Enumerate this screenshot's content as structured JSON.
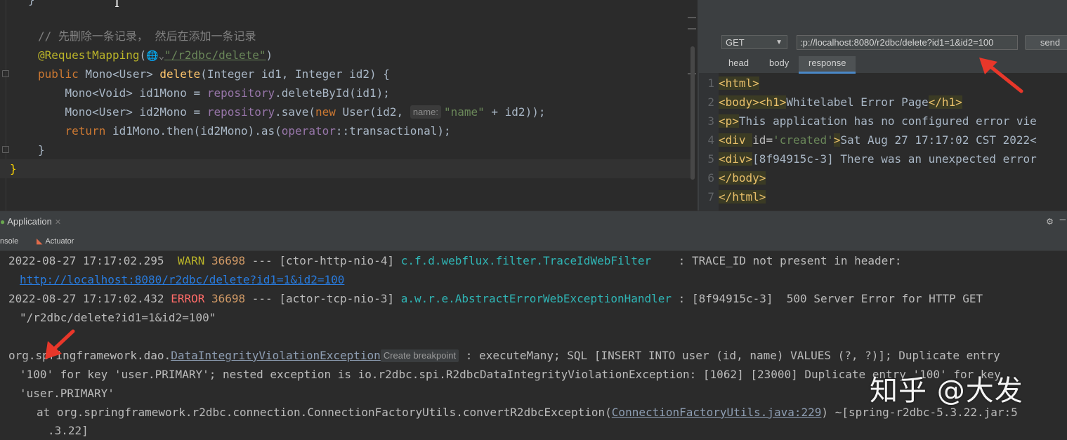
{
  "editor": {
    "lines": {
      "comment": "// 先删除一条记录， 然后在添加一条记录",
      "annotation": "@RequestMapping",
      "annotation_open": "(",
      "globe_hint": "🌐⌄",
      "annotation_path": "\"/r2dbc/delete\"",
      "annotation_close": ")",
      "sig_public": "public",
      "sig_type": " Mono<User> ",
      "sig_name": "delete",
      "sig_params": "(Integer id1, Integer id2) {",
      "l1_a": "    Mono<Void> id1Mono = ",
      "l1_field": "repository",
      "l1_b": ".deleteById(id1);",
      "l2_a": "    Mono<User> id2Mono = ",
      "l2_field": "repository",
      "l2_b": ".save(",
      "l2_new": "new",
      "l2_c": " User(id2, ",
      "l2_hint": "name:",
      "l2_str": "\"name\"",
      "l2_d": " + id2));",
      "l3_return": "    return",
      "l3_a": " id1Mono.then(id2Mono).as(",
      "l3_field": "operator",
      "l3_b": "::transactional);",
      "close_inner": "}",
      "close_outer": "}",
      "top_brace": "}",
      "cursor_glyph": "I"
    }
  },
  "http_client": {
    "method": "GET",
    "url": ":p://localhost:8080/r2dbc/delete?id1=1&id2=100",
    "send_label": "send",
    "tabs": [
      {
        "label": "head"
      },
      {
        "label": "body"
      },
      {
        "label": "response"
      }
    ],
    "response_lines": [
      {
        "n": "1",
        "t1": "<html>",
        "t2": "",
        "t3": ""
      },
      {
        "n": "2",
        "t1": "<body><h1>",
        "t2": "Whitelabel Error Page",
        "t3": "</h1>"
      },
      {
        "n": "3",
        "t1": "<p>",
        "t2": "This application has no configured error vie",
        "t3": ""
      },
      {
        "n": "4",
        "t1": "<div ",
        "t2": "id=",
        "t3": "'created'",
        "t4": ">",
        "t5": "Sat Aug 27 17:17:02 CST 2022<"
      },
      {
        "n": "5",
        "t1": "<div>",
        "t2": "[8f94915c-3] There was an unexpected error",
        "t3": ""
      },
      {
        "n": "6",
        "t1": "</body>",
        "t2": "",
        "t3": ""
      },
      {
        "n": "7",
        "t1": "</html>",
        "t2": "",
        "t3": ""
      }
    ]
  },
  "run_window": {
    "tab_label": "Application",
    "sub_tabs": {
      "console": "nsole",
      "actuator": "Actuator"
    },
    "console": {
      "l1_ts": "2022-08-27 17:17:02.295  ",
      "l1_level": "WARN",
      "l1_pid": " 36698",
      "l1_mid": " --- [ctor-http-nio-4] ",
      "l1_logger": "c.f.d.webflux.filter.TraceIdWebFilter",
      "l1_msg": "    : TRACE_ID not present in header:",
      "l2_link": "http://localhost:8080/r2dbc/delete?id1=1&id2=100",
      "l3_ts": "2022-08-27 17:17:02.432 ",
      "l3_level": "ERROR",
      "l3_pid": " 36698",
      "l3_mid": " --- [actor-tcp-nio-3] ",
      "l3_logger": "a.w.r.e.AbstractErrorWebExceptionHandler",
      "l3_msg": " : [8f94915c-3]  500 Server Error for HTTP GET",
      "l4": "\"/r2dbc/delete?id1=1&id2=100\"",
      "l5_pkg": "org.springframework.dao.",
      "l5_exc": "DataIntegrityViolationException",
      "l5_hint": "Create breakpoint",
      "l5_msg": " : executeMany; SQL [INSERT INTO user (id, name) VALUES (?, ?)]; Duplicate entry",
      "l6": "'100' for key 'user.PRIMARY'; nested exception is io.r2dbc.spi.R2dbcDataIntegrityViolationException: [1062] [23000] Duplicate entry '100' for key",
      "l7": "'user.PRIMARY'",
      "l8_a": "at org.springframework.r2dbc.connection.ConnectionFactoryUtils.convertR2dbcException(",
      "l8_link": "ConnectionFactoryUtils.java:229",
      "l8_b": ") ~[spring-r2dbc-5.3.22.jar:5",
      "l9": ".3.22]"
    }
  },
  "watermark": "知乎 @大发",
  "colors": {
    "accent": "#4a88c7",
    "arrow": "#e8372a",
    "error": "#ff6b68",
    "warn": "#bbb529"
  }
}
